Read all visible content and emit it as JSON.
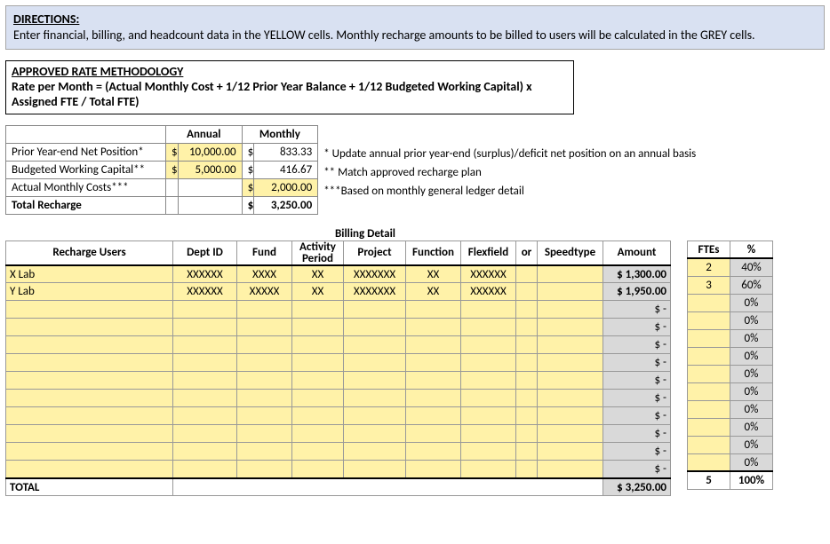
{
  "directions": {
    "heading": "DIRECTIONS:",
    "body": "Enter financial, billing, and headcount data in the YELLOW cells.  Monthly recharge amounts to be billed to users will be calculated in the GREY cells."
  },
  "methodology": {
    "heading": "APPROVED RATE METHODOLOGY",
    "formula": "Rate per Month = (Actual Monthly Cost + 1/12 Prior Year Balance + 1/12 Budgeted Working Capital) x Assigned FTE / Total FTE)"
  },
  "recharge": {
    "col_annual": "Annual",
    "col_monthly": "Monthly",
    "rows": [
      {
        "label": "Prior Year-end Net Position*",
        "annual": "10,000.00",
        "monthly": "833.33",
        "annual_yellow": true,
        "monthly_yellow": false
      },
      {
        "label": "Budgeted Working Capital**",
        "annual": "5,000.00",
        "monthly": "416.67",
        "annual_yellow": true,
        "monthly_yellow": false
      },
      {
        "label": "Actual Monthly Costs***",
        "annual": "",
        "monthly": "2,000.00",
        "annual_yellow": false,
        "monthly_yellow": true
      }
    ],
    "total_label": "Total Recharge",
    "total_monthly": "3,250.00",
    "notes": [
      "* Update annual prior year-end (surplus)/deficit net position on an annual basis",
      "** Match approved recharge plan",
      "***Based on monthly general ledger detail"
    ]
  },
  "billing": {
    "title": "Billing Detail",
    "headers": {
      "user": "Recharge Users",
      "dept": "Dept ID",
      "fund": "Fund",
      "activity": "Activity Period",
      "project": "Project",
      "function": "Function",
      "flex": "Flexfield",
      "or": "or",
      "speed": "Speedtype",
      "amount": "Amount",
      "ftes": "FTEs",
      "pct": "%"
    },
    "rows": [
      {
        "user": "X Lab",
        "dept": "XXXXXX",
        "fund": "XXXX",
        "act": "XX",
        "proj": "XXXXXXX",
        "func": "XX",
        "flex": "XXXXXX",
        "speed": "",
        "amount": "$ 1,300.00",
        "fte": "2",
        "pct": "40%"
      },
      {
        "user": "Y Lab",
        "dept": "XXXXXX",
        "fund": "XXXXX",
        "act": "XX",
        "proj": "XXXXXXX",
        "func": "XX",
        "flex": "XXXXXX",
        "speed": "",
        "amount": "$ 1,950.00",
        "fte": "3",
        "pct": "60%"
      },
      {
        "user": "",
        "dept": "",
        "fund": "",
        "act": "",
        "proj": "",
        "func": "",
        "flex": "",
        "speed": "",
        "amount": "",
        "fte": "",
        "pct": "0%"
      },
      {
        "user": "",
        "dept": "",
        "fund": "",
        "act": "",
        "proj": "",
        "func": "",
        "flex": "",
        "speed": "",
        "amount": "",
        "fte": "",
        "pct": "0%"
      },
      {
        "user": "",
        "dept": "",
        "fund": "",
        "act": "",
        "proj": "",
        "func": "",
        "flex": "",
        "speed": "",
        "amount": "",
        "fte": "",
        "pct": "0%"
      },
      {
        "user": "",
        "dept": "",
        "fund": "",
        "act": "",
        "proj": "",
        "func": "",
        "flex": "",
        "speed": "",
        "amount": "",
        "fte": "",
        "pct": "0%"
      },
      {
        "user": "",
        "dept": "",
        "fund": "",
        "act": "",
        "proj": "",
        "func": "",
        "flex": "",
        "speed": "",
        "amount": "",
        "fte": "",
        "pct": "0%"
      },
      {
        "user": "",
        "dept": "",
        "fund": "",
        "act": "",
        "proj": "",
        "func": "",
        "flex": "",
        "speed": "",
        "amount": "",
        "fte": "",
        "pct": "0%"
      },
      {
        "user": "",
        "dept": "",
        "fund": "",
        "act": "",
        "proj": "",
        "func": "",
        "flex": "",
        "speed": "",
        "amount": "",
        "fte": "",
        "pct": "0%"
      },
      {
        "user": "",
        "dept": "",
        "fund": "",
        "act": "",
        "proj": "",
        "func": "",
        "flex": "",
        "speed": "",
        "amount": "",
        "fte": "",
        "pct": "0%"
      },
      {
        "user": "",
        "dept": "",
        "fund": "",
        "act": "",
        "proj": "",
        "func": "",
        "flex": "",
        "speed": "",
        "amount": "",
        "fte": "",
        "pct": "0%"
      },
      {
        "user": "",
        "dept": "",
        "fund": "",
        "act": "",
        "proj": "",
        "func": "",
        "flex": "",
        "speed": "",
        "amount": "",
        "fte": "",
        "pct": "0%"
      }
    ],
    "total_label": "TOTAL",
    "total_amount": "$ 3,250.00",
    "total_fte": "5",
    "total_pct": "100%",
    "empty_amount": "$        -"
  }
}
